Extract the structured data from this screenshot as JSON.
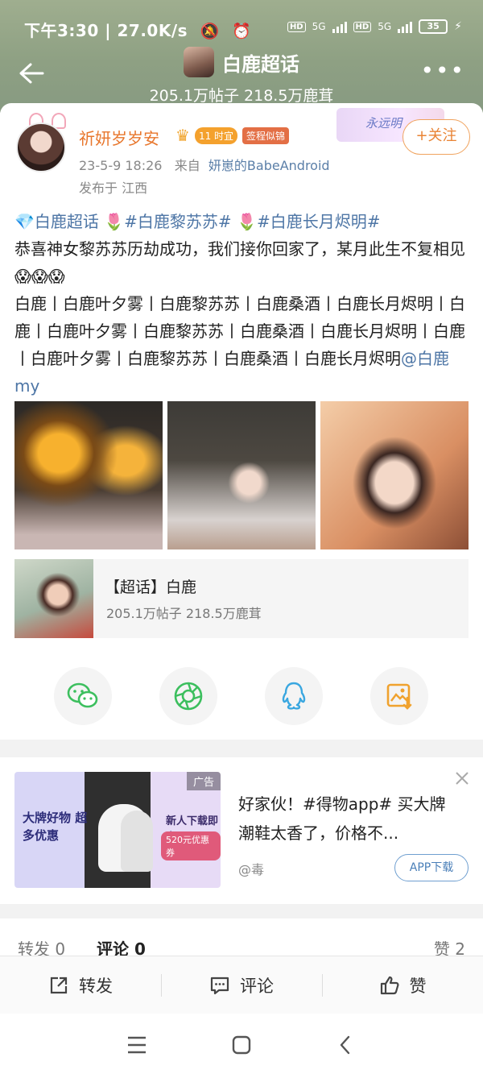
{
  "status_bar": {
    "time": "下午3:30",
    "speed": "27.0K/s",
    "net1": "5G",
    "net2": "5G",
    "hd": "HD",
    "battery": "35"
  },
  "nav": {
    "title": "白鹿超话",
    "subtitle": "205.1万帖子 218.5万鹿茸"
  },
  "post": {
    "username": "祈妍岁岁安",
    "badge_1": "11 时宜",
    "badge_2": "签程似锦",
    "banner_text": "永远明",
    "follow_label": "+关注",
    "time": "23-5-9 18:26",
    "from_label": "来自",
    "source": "妍崽的BabeAndroid",
    "location": "发布于 江西",
    "tags_line": [
      {
        "text": "白鹿超话",
        "tag": true
      },
      {
        "text": " 🌷",
        "tag": false
      },
      {
        "text": "#白鹿黎苏苏#",
        "tag": true
      },
      {
        "text": " 🌷",
        "tag": false
      },
      {
        "text": "#白鹿长月烬明#",
        "tag": true
      }
    ],
    "body": "恭喜神女黎苏苏历劫成功，我们接你回家了，某月此生不复相见😱😱😱",
    "body2": " 白鹿丨白鹿叶夕雾丨白鹿黎苏苏丨白鹿桑酒丨白鹿长月烬明丨白鹿丨白鹿叶夕雾丨白鹿黎苏苏丨白鹿桑酒丨白鹿长月烬明丨白鹿丨白鹿叶夕雾丨白鹿黎苏苏丨白鹿桑酒丨白鹿长月烬明",
    "mention": "@白鹿my"
  },
  "topic_card": {
    "name": "【超话】白鹿",
    "stats": "205.1万帖子 218.5万鹿茸"
  },
  "share": [
    "wechat-icon",
    "moments-icon",
    "qq-icon",
    "save-image-icon"
  ],
  "ad": {
    "tag": "广告",
    "image_left": "大牌好物 超多优惠",
    "image_right": "新人下载即享",
    "coupon": "520元优惠券",
    "title": "好家伙！#得物app# 买大牌潮鞋太香了，价格不...",
    "source": "@毒",
    "button": "APP下载"
  },
  "tabs": {
    "repost": "转发 0",
    "comment": "评论 0",
    "like": "赞 2"
  },
  "actions": {
    "repost": "转发",
    "comment": "评论",
    "like": "赞"
  }
}
